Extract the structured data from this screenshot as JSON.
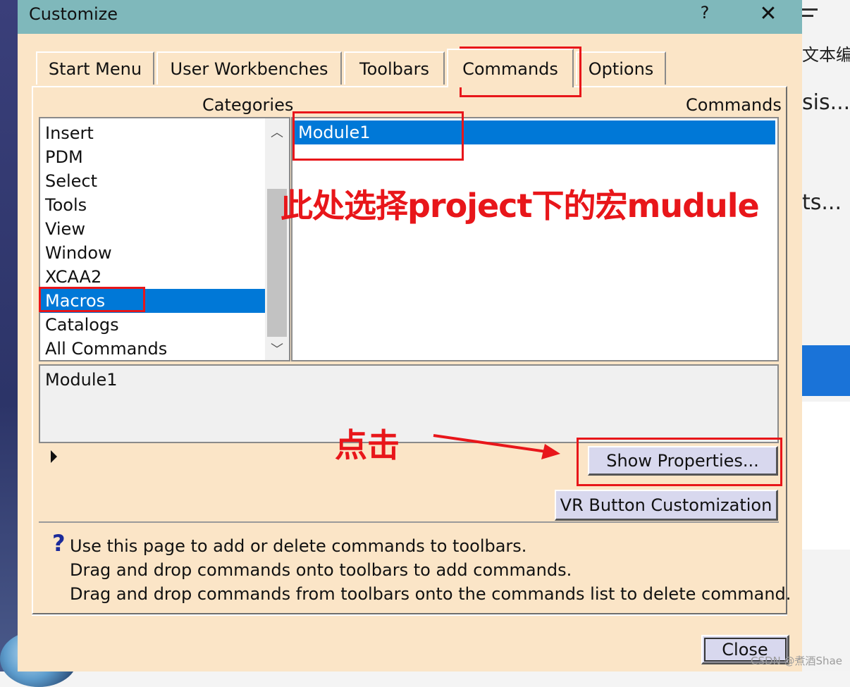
{
  "window": {
    "title": "Customize",
    "help_label": "?",
    "close_label": "✕"
  },
  "tabs": [
    {
      "label": "Start Menu"
    },
    {
      "label": "User Workbenches"
    },
    {
      "label": "Toolbars"
    },
    {
      "label": "Commands",
      "active": true
    },
    {
      "label": "Options"
    }
  ],
  "categories": {
    "header": "Categories",
    "items": [
      "Insert",
      "PDM",
      "Select",
      "Tools",
      "View",
      "Window",
      "XCAA2",
      "Macros",
      "Catalogs",
      "All Commands"
    ],
    "selected": "Macros"
  },
  "commands": {
    "header": "Commands",
    "items": [
      "Module1"
    ],
    "selected": "Module1"
  },
  "description": {
    "text": "Module1"
  },
  "buttons": {
    "show_properties": "Show Properties...",
    "vr_customization": "VR Button Customization",
    "close": "Close"
  },
  "info": {
    "lines": [
      "Use this page to add or delete commands to toolbars.",
      "Drag and drop commands onto toolbars to add commands.",
      "Drag and drop commands from toolbars onto the commands list to delete command."
    ]
  },
  "annotations": {
    "note_select": "此处选择project下的宏mudule",
    "note_click": "点击",
    "color": "#e8161a"
  },
  "background_app": {
    "text_top": "文本编辑",
    "text_a": "sis...",
    "text_b": "ts..."
  },
  "watermark": "CSDN @煮酒Shae",
  "colors": {
    "titlebar": "#7fb8bb",
    "dialog_bg": "#fbe5c7",
    "selection": "#0078d7"
  }
}
